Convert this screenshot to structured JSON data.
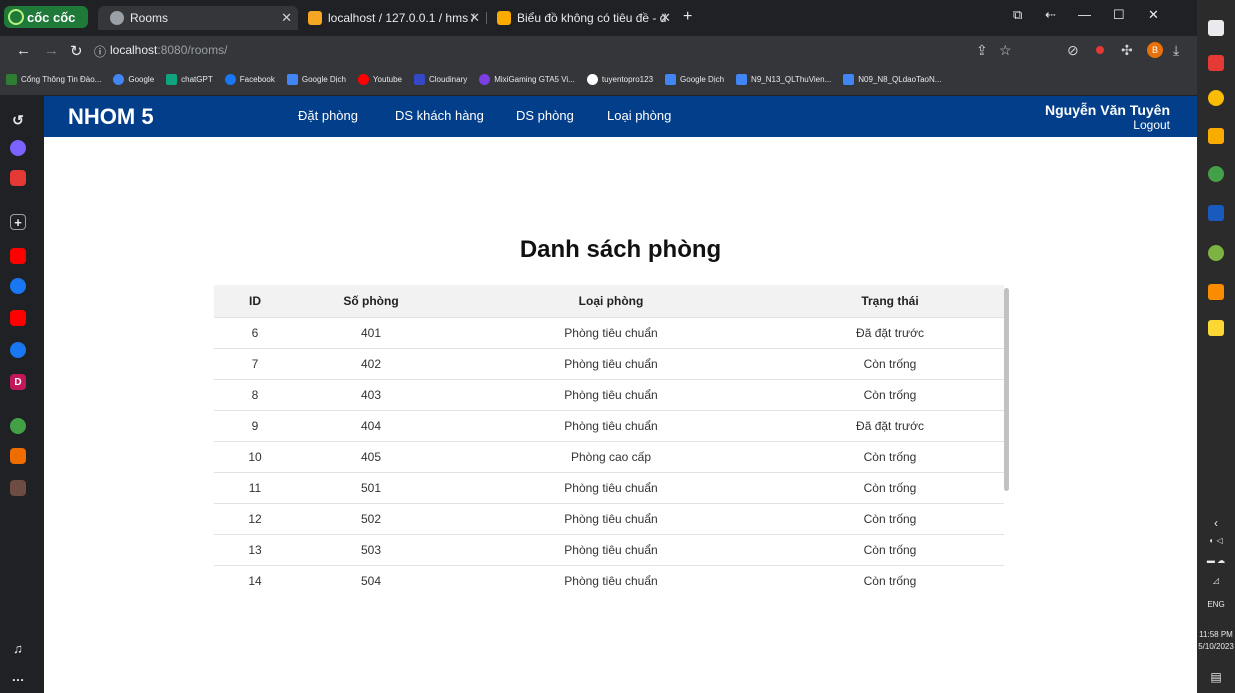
{
  "browser": {
    "brand": "cốc cốc",
    "tabs": [
      {
        "title": "Rooms",
        "active": true
      },
      {
        "title": "localhost / 127.0.0.1 / hms /",
        "active": false
      },
      {
        "title": "Biểu đồ không có tiêu đề - d",
        "active": false
      }
    ],
    "new_tab": "+",
    "url_host": "localhost",
    "url_rest": ":8080/rooms/",
    "profile_initial": "B",
    "bookmarks": [
      {
        "label": "Cổng Thông Tin Đào...",
        "color": "#2e7d32"
      },
      {
        "label": "Google",
        "color": "#4285f4"
      },
      {
        "label": "chatGPT",
        "color": "#10a37f"
      },
      {
        "label": "Facebook",
        "color": "#1877f2"
      },
      {
        "label": "Google Dịch",
        "color": "#4285f4"
      },
      {
        "label": "Youtube",
        "color": "#ff0000"
      },
      {
        "label": "Cloudinary",
        "color": "#3448c5"
      },
      {
        "label": "MixiGaming GTA5 Vi...",
        "color": "#7b3fe4"
      },
      {
        "label": "tuyentopro123",
        "color": "#ffffff"
      },
      {
        "label": "Google Dịch",
        "color": "#4285f4"
      },
      {
        "label": "N9_N13_QLThuVien...",
        "color": "#4285f4"
      },
      {
        "label": "N09_N8_QLdaoTaoN...",
        "color": "#4285f4"
      }
    ]
  },
  "taskbar": {
    "lang": "ENG",
    "time": "11:58 PM",
    "date": "5/10/2023"
  },
  "nav": {
    "brand": "NHOM 5",
    "links": [
      "Đặt phòng",
      "DS khách hàng",
      "DS phòng",
      "Loại phòng"
    ],
    "user": "Nguyễn Văn Tuyên",
    "logout": "Logout"
  },
  "main": {
    "title": "Danh sách phòng",
    "columns": [
      "ID",
      "Số phòng",
      "Loại phòng",
      "Trạng thái"
    ],
    "rows": [
      [
        "6",
        "401",
        "Phòng tiêu chuẩn",
        "Đã đặt trước"
      ],
      [
        "7",
        "402",
        "Phòng tiêu chuẩn",
        "Còn trống"
      ],
      [
        "8",
        "403",
        "Phòng tiêu chuẩn",
        "Còn trống"
      ],
      [
        "9",
        "404",
        "Phòng tiêu chuẩn",
        "Đã đặt trước"
      ],
      [
        "10",
        "405",
        "Phòng cao cấp",
        "Còn trống"
      ],
      [
        "11",
        "501",
        "Phòng tiêu chuẩn",
        "Còn trống"
      ],
      [
        "12",
        "502",
        "Phòng tiêu chuẩn",
        "Còn trống"
      ],
      [
        "13",
        "503",
        "Phòng tiêu chuẩn",
        "Còn trống"
      ],
      [
        "14",
        "504",
        "Phòng tiêu chuẩn",
        "Còn trống"
      ]
    ]
  },
  "colors": {
    "navbar": "#023e8a",
    "header_bg": "#f2f2f2"
  }
}
